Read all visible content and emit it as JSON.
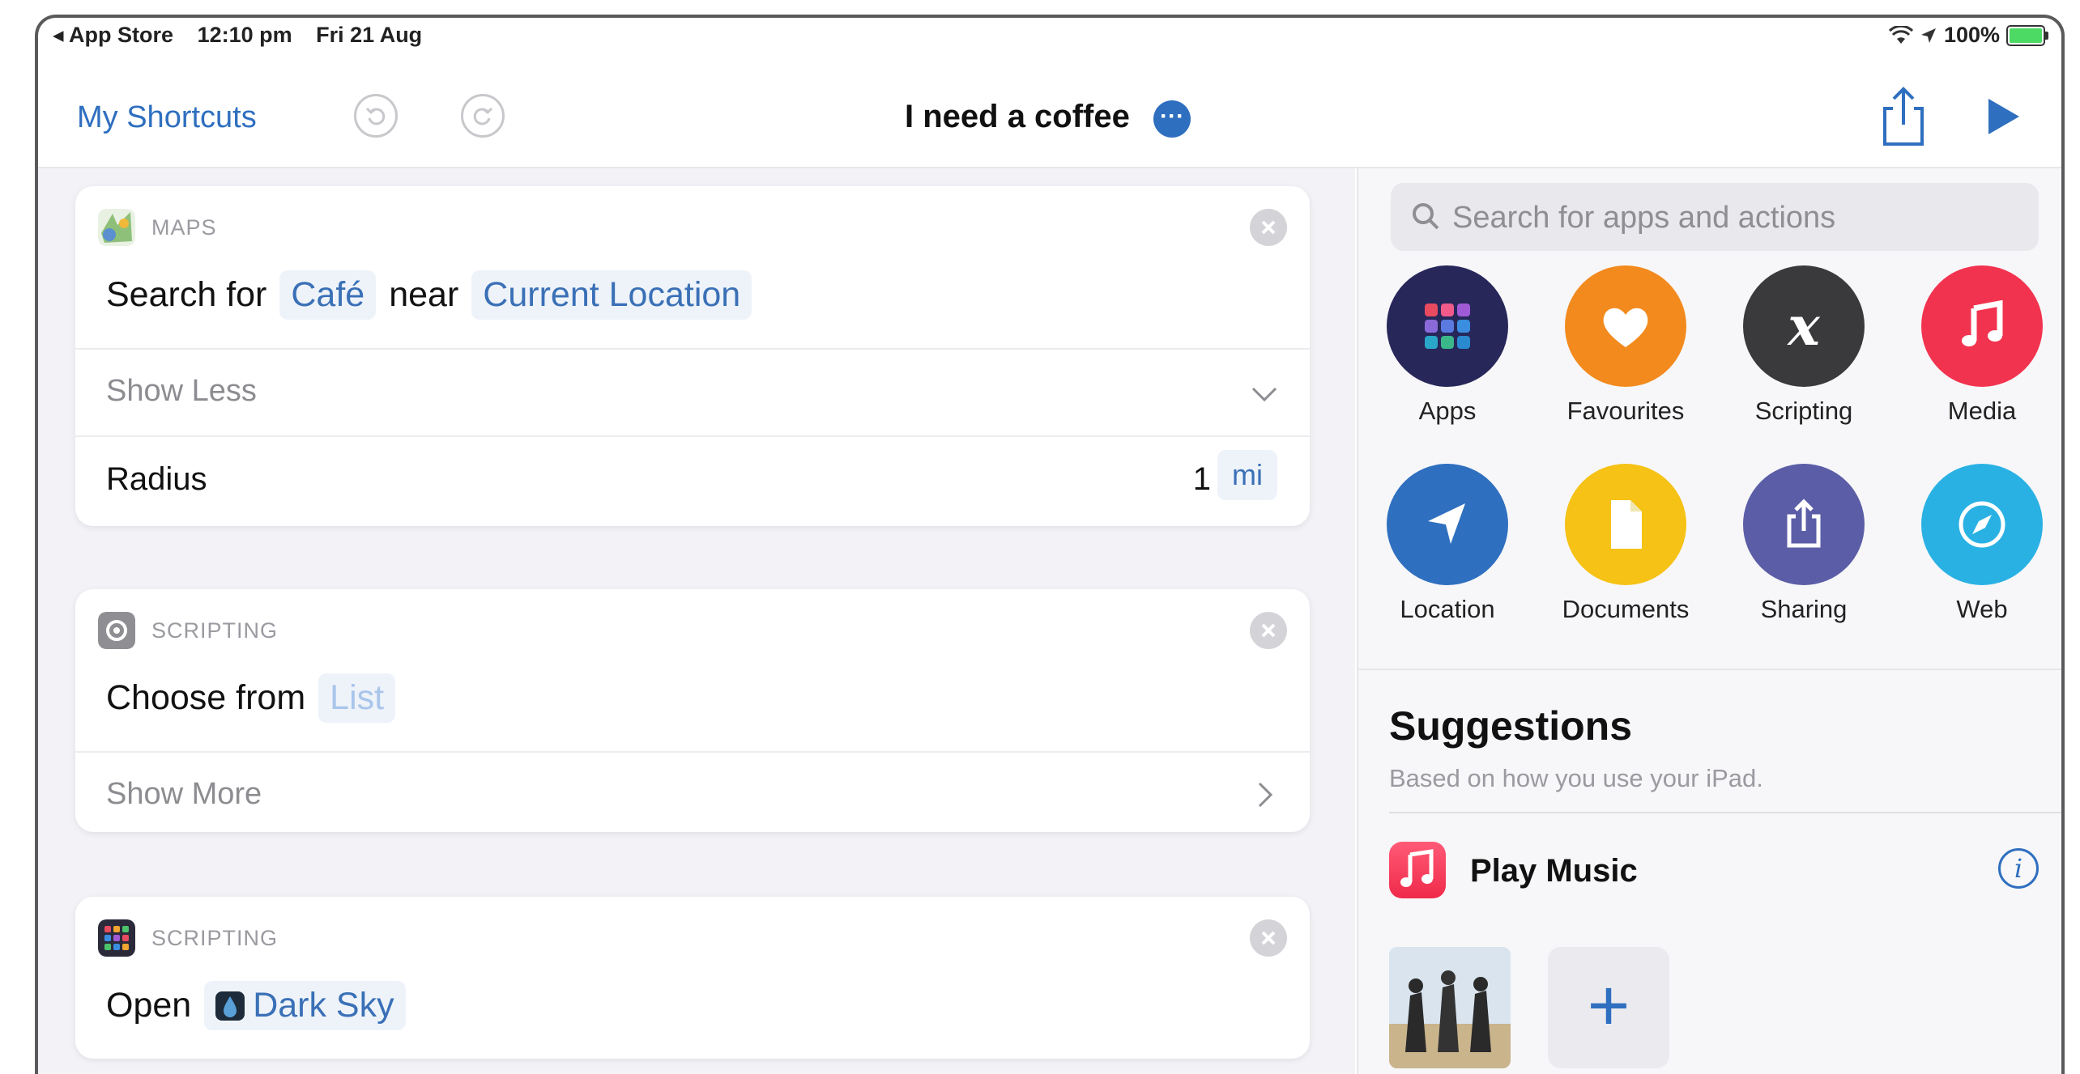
{
  "status_bar": {
    "back_app": "◂ App Store",
    "time": "12:10 pm",
    "date": "Fri 21 Aug",
    "battery": "100%"
  },
  "nav": {
    "back_label": "My Shortcuts",
    "title": "I need a coffee",
    "more_glyph": "···"
  },
  "actions": [
    {
      "app": "MAPS",
      "verb": "Search for",
      "param1": "Café",
      "joiner": "near",
      "param2": "Current Location",
      "toggle": "Show Less",
      "radius_label": "Radius",
      "radius_value": "1",
      "radius_unit": "mi"
    },
    {
      "app": "SCRIPTING",
      "verb": "Choose from",
      "param1": "List",
      "toggle": "Show More"
    },
    {
      "app": "SCRIPTING",
      "verb": "Open",
      "param1": "Dark Sky"
    }
  ],
  "panel": {
    "search_placeholder": "Search for apps and actions",
    "categories": [
      {
        "label": "Apps",
        "color": "#27275a",
        "icon": "apps-grid-icon"
      },
      {
        "label": "Favourites",
        "color": "#f28a1e",
        "icon": "heart-icon"
      },
      {
        "label": "Scripting",
        "color": "#3a3a3c",
        "icon": "x-script-icon"
      },
      {
        "label": "Media",
        "color": "#f2334f",
        "icon": "music-note-icon"
      },
      {
        "label": "Location",
        "color": "#2f6fbf",
        "icon": "location-arrow-icon"
      },
      {
        "label": "Documents",
        "color": "#f5c215",
        "icon": "document-icon"
      },
      {
        "label": "Sharing",
        "color": "#5b5ea6",
        "icon": "share-icon"
      },
      {
        "label": "Web",
        "color": "#2ab1e4",
        "icon": "compass-icon"
      }
    ],
    "suggestions_title": "Suggestions",
    "suggestions_subtitle": "Based on how you use your iPad.",
    "suggestion_item": "Play Music",
    "add_glyph": "+"
  }
}
